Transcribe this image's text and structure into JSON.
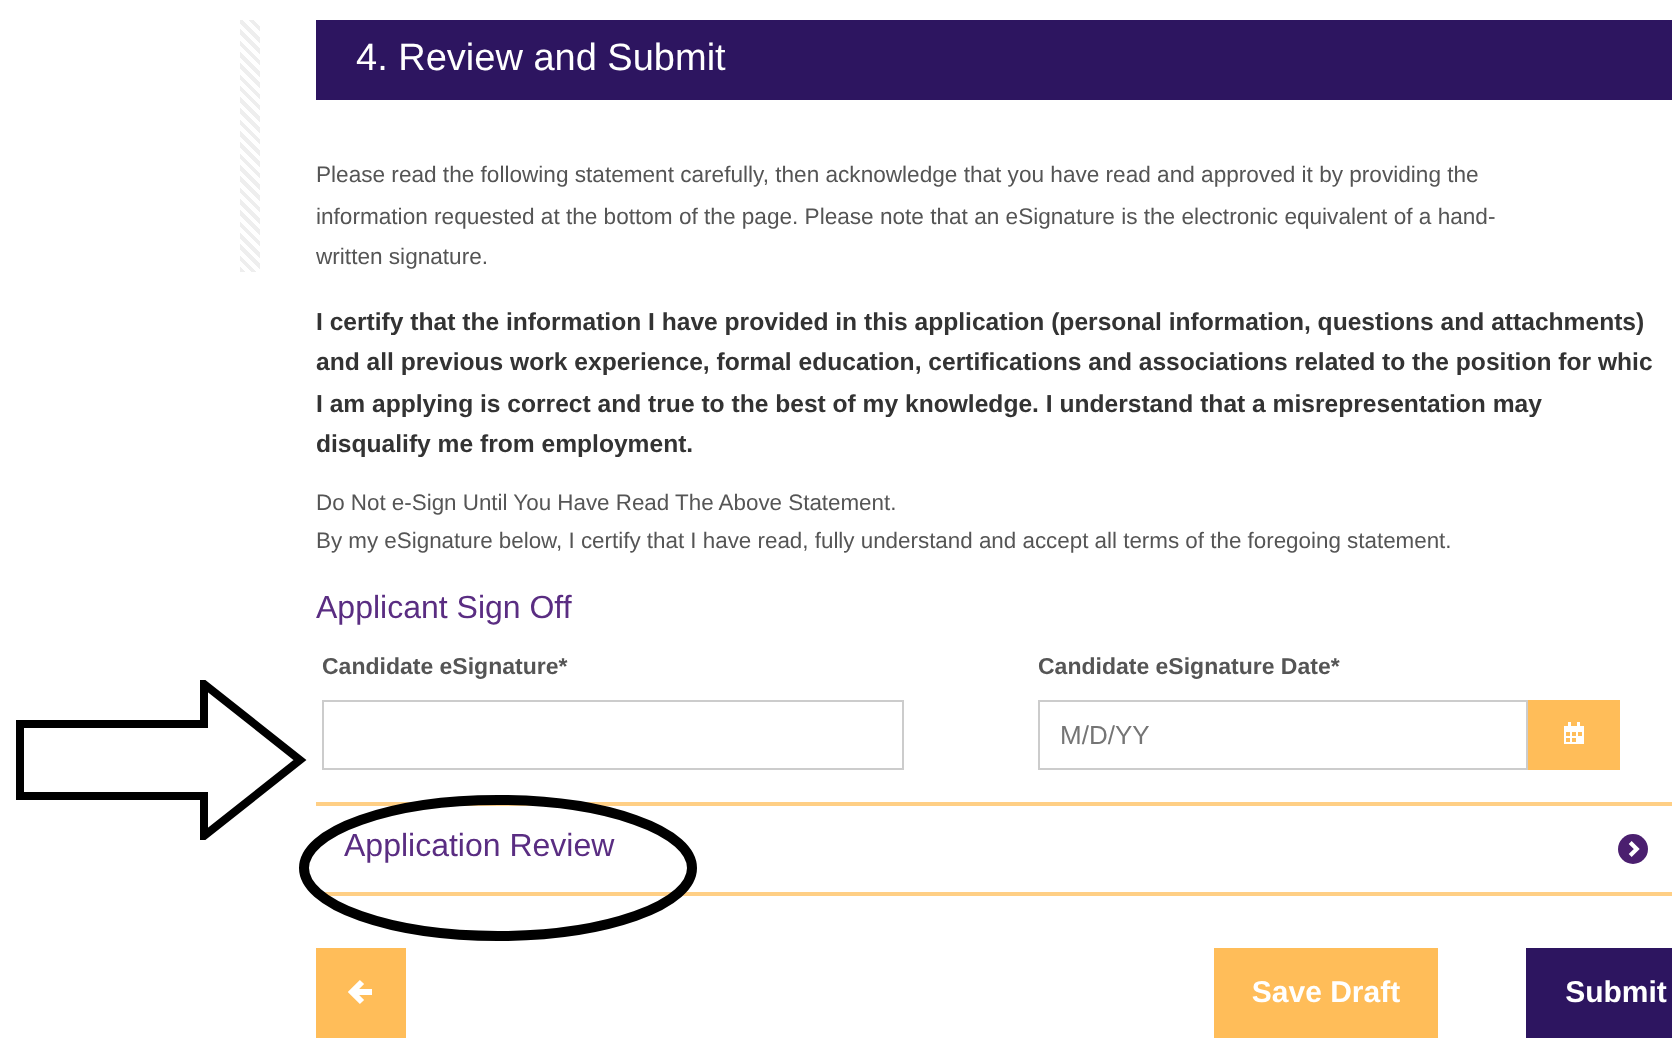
{
  "section_title": "4. Review and Submit",
  "intro": "Please read the following statement carefully, then acknowledge that you have read and approved it by providing the information requested at the bottom of the page.  Please note that an eSignature is the electronic equivalent of a hand-written signature.",
  "certification_lines": [
    "I certify that the information I have provided in this application (personal information, questions and attachments)",
    "and all previous work experience, formal education, certifications and associations related to the position for whic",
    "I am applying is correct and true to the best of my knowledge.  I understand that a misrepresentation may",
    "disqualify me from employment."
  ],
  "notice_lines": [
    "Do Not e-Sign Until You Have Read The Above Statement.",
    "By my eSignature below, I certify that I have read, fully understand and accept all terms of the foregoing statement."
  ],
  "sign_off_title": "Applicant Sign Off",
  "signature_field": {
    "label": "Candidate eSignature*"
  },
  "date_field": {
    "label": "Candidate eSignature Date*",
    "placeholder": "M/D/YY"
  },
  "accordion": {
    "title": "Application Review",
    "expanded": false
  },
  "buttons": {
    "save": "Save Draft",
    "submit": "Submit"
  }
}
